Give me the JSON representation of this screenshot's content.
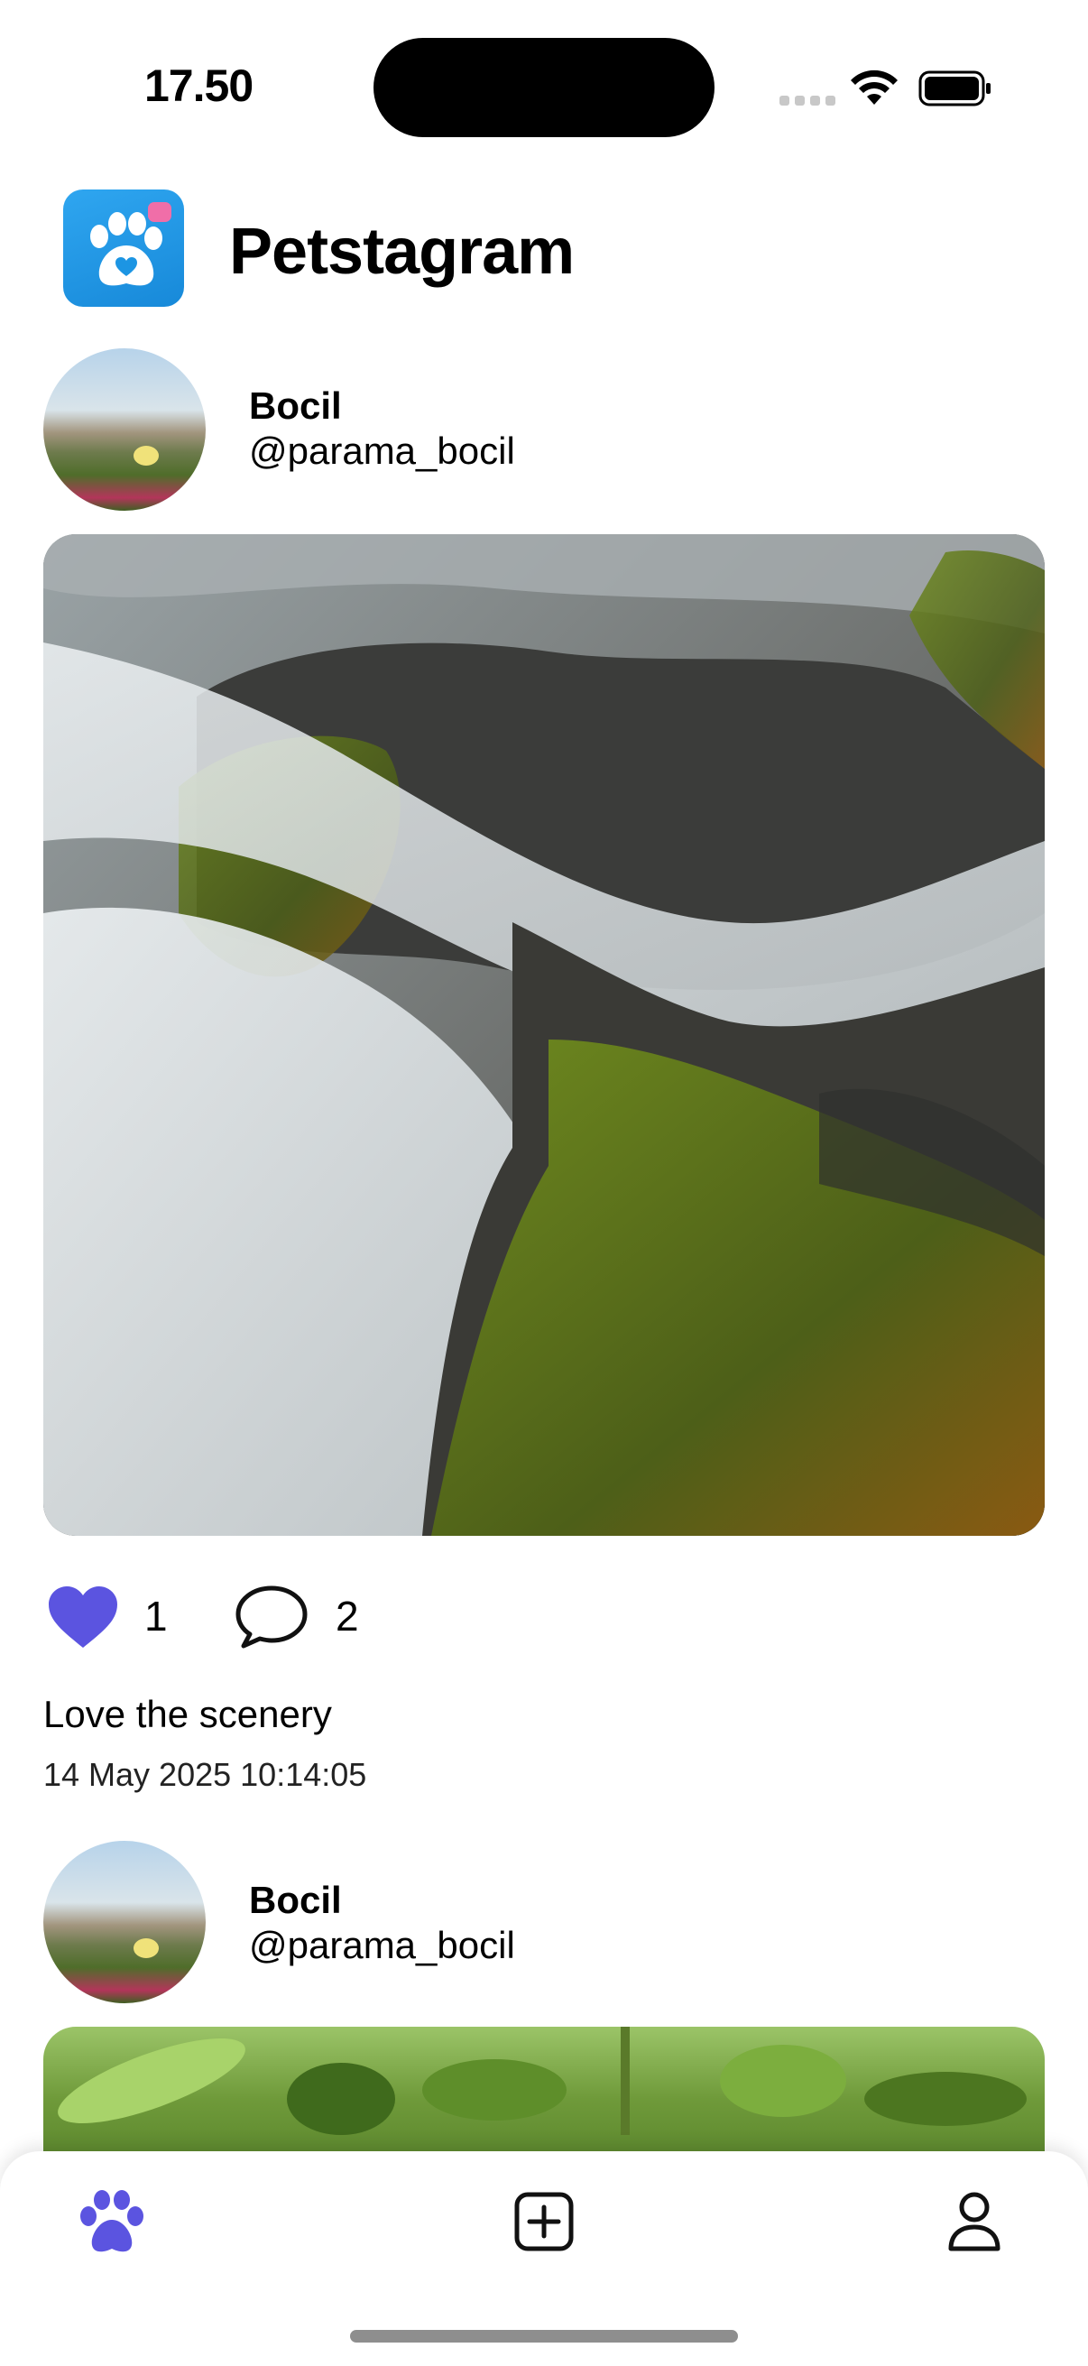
{
  "status_bar": {
    "time": "17.50"
  },
  "header": {
    "title": "Petstagram",
    "logo_icon": "paw-heart-icon"
  },
  "posts": [
    {
      "user": {
        "name": "Bocil",
        "handle": "@parama_bocil"
      },
      "image_description_icon": "waterfall-photo",
      "likes": "1",
      "comments": "2",
      "liked": true,
      "caption": "Love the scenery",
      "timestamp": "14 May 2025 10:14:05"
    },
    {
      "user": {
        "name": "Bocil",
        "handle": "@parama_bocil"
      },
      "image_description_icon": "leaves-photo"
    }
  ],
  "tab_bar": {
    "items": [
      {
        "icon": "paw-icon",
        "active": true
      },
      {
        "icon": "add-post-icon",
        "active": false
      },
      {
        "icon": "profile-icon",
        "active": false
      }
    ]
  },
  "colors": {
    "accent": "#5b54e0",
    "logo_blue": "#1c95e3",
    "logo_badge": "#f06ea8"
  }
}
